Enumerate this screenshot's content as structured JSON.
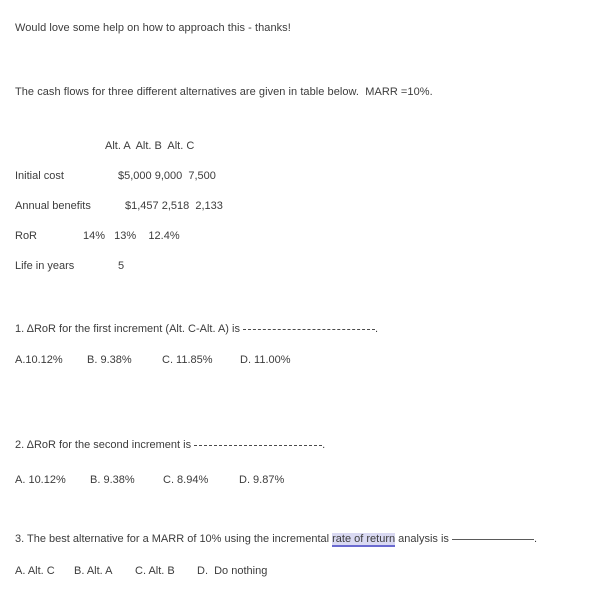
{
  "intro": {
    "line1": "Would love some help on how to approach this - thanks!",
    "line2": "The cash flows for three different alternatives are given in table below.  MARR =10%."
  },
  "table": {
    "headers": [
      "Alt. A",
      "Alt. B",
      "Alt. C"
    ],
    "header_text": "Alt. A  Alt. B  Alt. C",
    "rows": [
      {
        "label": "Initial cost",
        "values_text": "$5,000 9,000  7,500",
        "values": [
          "$5,000",
          "9,000",
          "7,500"
        ]
      },
      {
        "label": "Annual benefits",
        "values_text": "$1,457 2,518  2,133",
        "values": [
          "$1,457",
          "2,518",
          "2,133"
        ]
      },
      {
        "label": "RoR",
        "values_text": "14%   13%    12.4%",
        "values": [
          "14%",
          "13%",
          "12.4%"
        ]
      },
      {
        "label": "Life in years",
        "values_text": "5",
        "values": [
          "5",
          "",
          ""
        ]
      }
    ]
  },
  "questions": [
    {
      "number": "1.",
      "prompt_before": "1. ΔRoR for the first increment (Alt. C-Alt. A) is ",
      "prompt_after": ".",
      "options": [
        "A.10.12%",
        "B. 9.38%",
        "C. 11.85%",
        "D. 11.00%"
      ]
    },
    {
      "number": "2.",
      "prompt_before": "2. ΔRoR for the second increment is ",
      "prompt_after": ".",
      "options": [
        "A. 10.12%",
        "B. 9.38%",
        "C. 8.94%",
        "D. 9.87%"
      ]
    },
    {
      "number": "3.",
      "prompt_part1": "3. The best alternative for a MARR of 10% using the incremental ",
      "highlight": "rate of return",
      "prompt_part2": " analysis is ",
      "prompt_after": ".",
      "options": [
        "A. Alt. C",
        "B. Alt. A",
        "C. Alt. B",
        "D.  Do nothing"
      ]
    }
  ],
  "colors": {
    "text": "#3c3c3c",
    "background": "#ffffff",
    "highlight_background": "#d9d9f2",
    "highlight_underline": "#6a6ad0"
  }
}
